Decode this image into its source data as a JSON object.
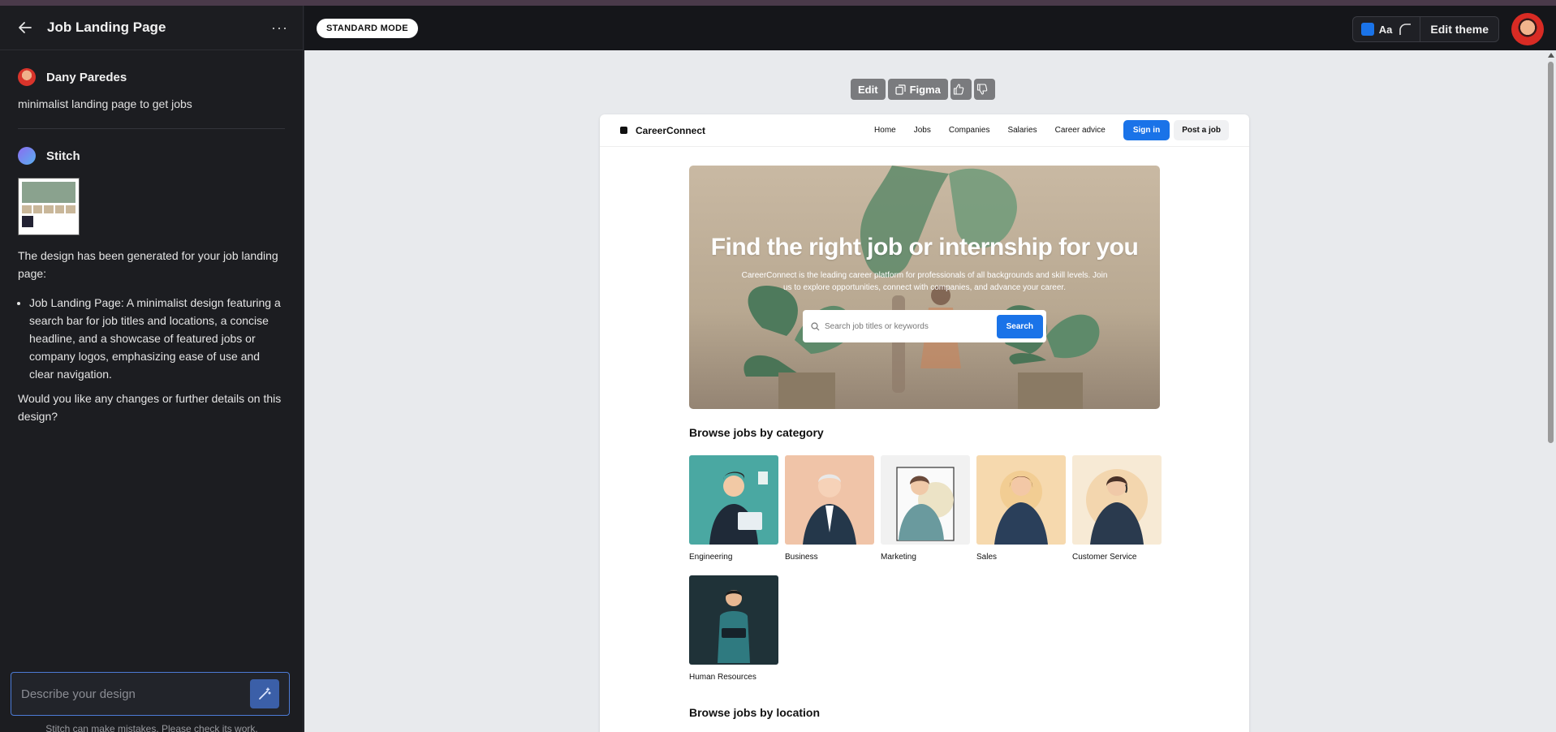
{
  "left": {
    "title": "Job Landing Page",
    "user_name": "Dany Paredes",
    "user_message": "minimalist landing page to get jobs",
    "bot_name": "Stitch",
    "bot_intro": "The design has been generated for your job landing page:",
    "bot_bullet": "Job Landing Page: A minimalist design featuring a search bar for job titles and locations, a concise headline, and a showcase of featured jobs or company logos, emphasizing ease of use and clear navigation.",
    "bot_question": "Would you like any changes or further details on this design?",
    "compose_placeholder": "Describe your design",
    "disclaimer": "Stitch can make mistakes. Please check its work."
  },
  "topbar": {
    "mode": "STANDARD MODE",
    "aa": "Aa",
    "edit_theme": "Edit theme",
    "accent": "#1a73e8"
  },
  "tools": {
    "edit": "Edit",
    "figma": "Figma"
  },
  "site": {
    "brand": "CareerConnect",
    "nav": [
      "Home",
      "Jobs",
      "Companies",
      "Salaries",
      "Career advice"
    ],
    "sign_in": "Sign in",
    "post_job": "Post a job",
    "hero_title": "Find the right job or internship for you",
    "hero_sub": "CareerConnect is the leading career platform for professionals of all backgrounds and skill levels. Join us to explore opportunities, connect with companies, and advance your career.",
    "search_placeholder": "Search job titles or keywords",
    "search_button": "Search",
    "browse_category": "Browse jobs by category",
    "categories": [
      "Engineering",
      "Business",
      "Marketing",
      "Sales",
      "Customer Service",
      "Human Resources"
    ],
    "browse_location": "Browse jobs by location"
  }
}
